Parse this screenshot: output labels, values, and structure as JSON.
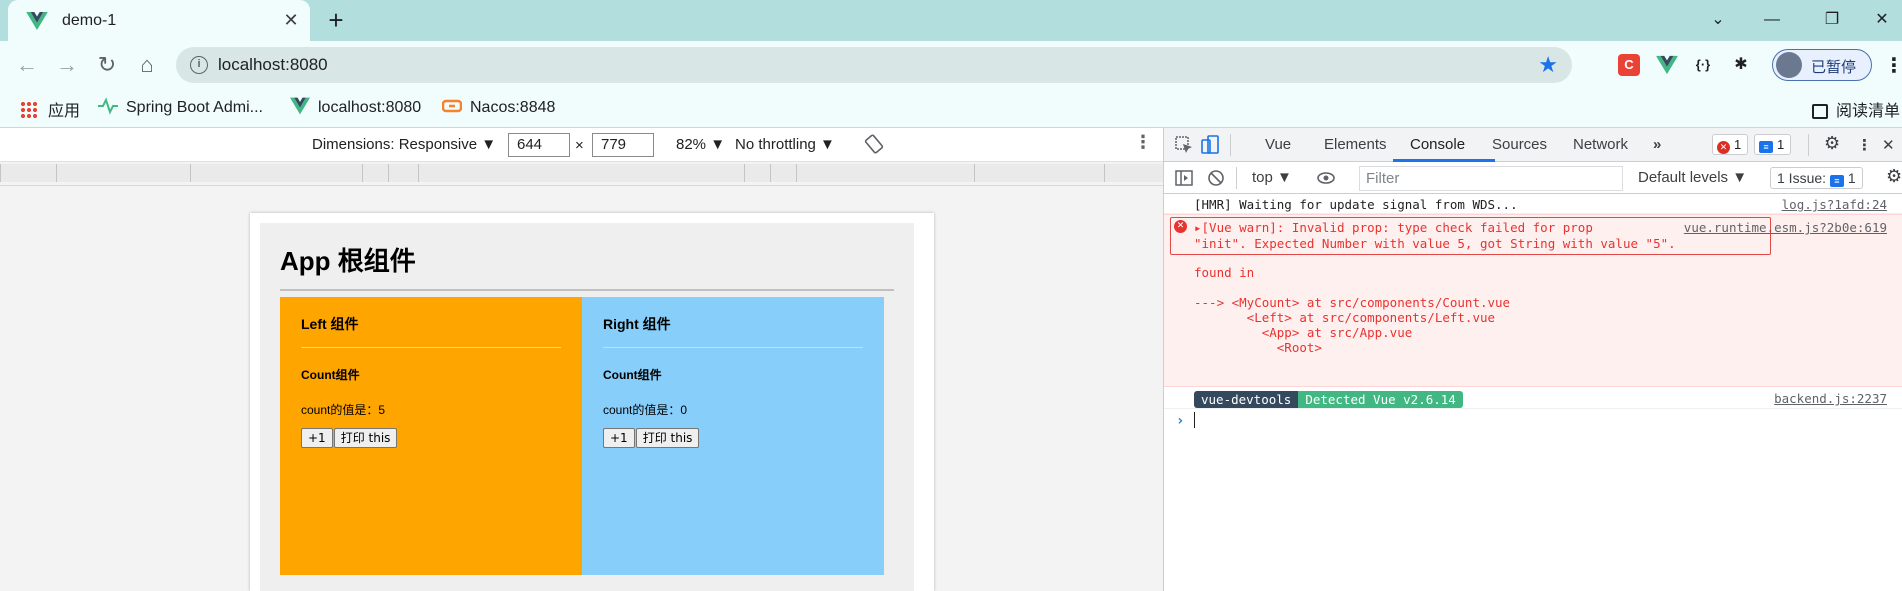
{
  "browser": {
    "tab": {
      "title": "demo-1",
      "close": "✕"
    },
    "new_tab": "+",
    "window_controls": {
      "minimize": "—",
      "restore": "❐",
      "close": "✕",
      "dropdown": "⌄"
    },
    "address": {
      "url": "localhost:8080",
      "info": "i"
    },
    "profile": {
      "label": "已暂停"
    },
    "extensions": [
      {
        "name": "c-extension-icon",
        "label": "C",
        "bg": "#ea4335",
        "fg": "#ffffff"
      },
      {
        "name": "vue-extension-icon",
        "label": "",
        "bg": "transparent",
        "fg": "#41b883"
      },
      {
        "name": "json-extension-icon",
        "label": "{·}",
        "bg": "transparent",
        "fg": "#202124"
      },
      {
        "name": "puzzle-extension-icon",
        "label": "✱",
        "bg": "transparent",
        "fg": "#202124"
      }
    ]
  },
  "bookmarks": {
    "apps": "应用",
    "items": [
      {
        "label": "Spring Boot Admi...",
        "icon": "pulse-icon",
        "color": "#42b983"
      },
      {
        "label": "localhost:8080",
        "icon": "vue-icon",
        "color": "#41b883"
      },
      {
        "label": "Nacos:8848",
        "icon": "nacos-icon",
        "color": "#f5832a"
      }
    ],
    "reading_list": "阅读清单"
  },
  "device_toolbar": {
    "dimensions_label": "Dimensions: Responsive ▼",
    "width": "644",
    "times": "×",
    "height": "779",
    "zoom": "82% ▼",
    "throttling": "No throttling ▼"
  },
  "app": {
    "title": "App 根组件",
    "left": {
      "title": "Left 组件",
      "count_title": "Count组件",
      "count_text": "count的值是：5",
      "inc_label": "+1",
      "print_label": "打印 this",
      "bg": "#ffa500"
    },
    "right": {
      "title": "Right 组件",
      "count_title": "Count组件",
      "count_text": "count的值是：0",
      "inc_label": "+1",
      "print_label": "打印 this",
      "bg": "#87cefa"
    }
  },
  "devtools": {
    "tabs": [
      "Vue",
      "Elements",
      "Console",
      "Sources",
      "Network"
    ],
    "active_tab": "Console",
    "more_tabs": "»",
    "error_count": "1",
    "message_count": "1",
    "context": "top ▼",
    "filter_placeholder": "Filter",
    "levels": "Default levels ▼",
    "issues": "1 Issue:",
    "issues_count": "1"
  },
  "console": {
    "hmr": {
      "text": "[HMR] Waiting for update signal from WDS...",
      "source": "log.js?1afd:24"
    },
    "error": {
      "icon": "✕",
      "line1": "▸[Vue warn]: Invalid prop: type check failed for prop",
      "line2": "\"init\". Expected Number with value 5, got String with value \"5\".",
      "source": "vue.runtime.esm.js?2b0e:619",
      "found_in": "found in",
      "trace": [
        "---> <MyCount> at src/components/Count.vue",
        "       <Left> at src/components/Left.vue",
        "         <App> at src/App.vue",
        "           <Root>"
      ]
    },
    "devtools_msg": {
      "tag": "vue-devtools",
      "text": "Detected Vue v2.6.14",
      "source": "backend.js:2237"
    },
    "prompt": "›"
  }
}
